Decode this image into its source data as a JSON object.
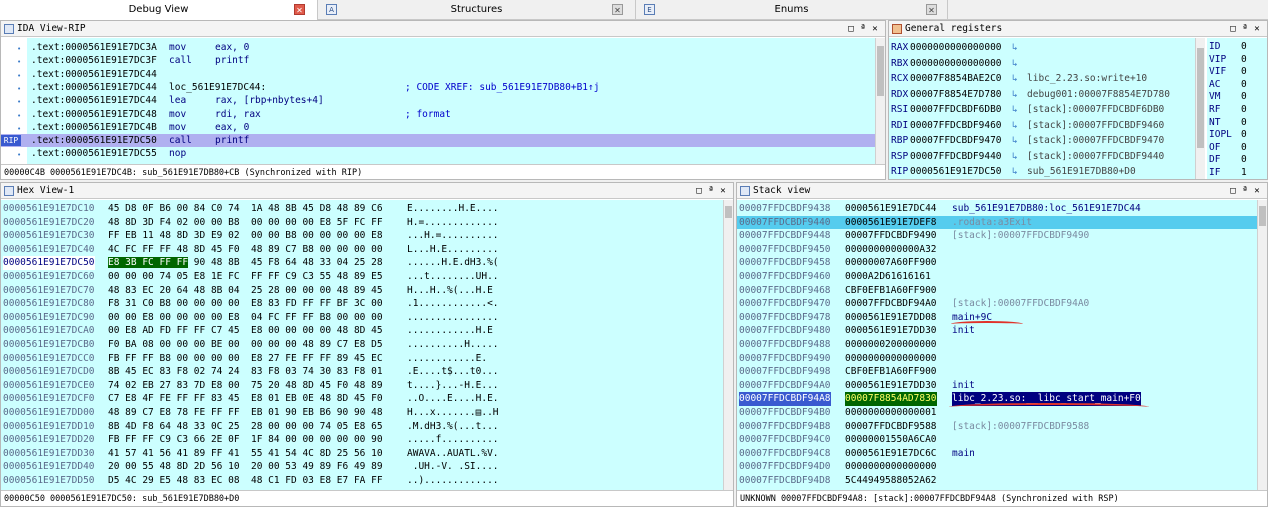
{
  "tabs": [
    {
      "label": "Debug View",
      "active": true
    },
    {
      "label": "Structures",
      "active": false
    },
    {
      "label": "Enums",
      "active": false
    }
  ],
  "ida_view": {
    "title": "IDA View-RIP",
    "rip_label": "RIP",
    "lines": [
      {
        "addr": ".text:0000561E91E7DC3A",
        "label": "",
        "mnem": "mov",
        "ops": "eax, 0",
        "hl": "eax",
        "comment": ""
      },
      {
        "addr": ".text:0000561E91E7DC3F",
        "label": "",
        "mnem": "call",
        "ops": "printf",
        "hl": "",
        "comment": ""
      },
      {
        "addr": ".text:0000561E91E7DC44",
        "label": "",
        "mnem": "",
        "ops": "",
        "hl": "",
        "comment": ""
      },
      {
        "addr": ".text:0000561E91E7DC44",
        "label": "loc_561E91E7DC44:",
        "mnem": "",
        "ops": "",
        "hl": "",
        "comment": "; CODE XREF: sub_561E91E7DB80+B1↑j"
      },
      {
        "addr": ".text:0000561E91E7DC44",
        "label": "",
        "mnem": "lea",
        "ops": "rax, [rbp+nbytes+4]",
        "hl": "rax",
        "comment": ""
      },
      {
        "addr": ".text:0000561E91E7DC48",
        "label": "",
        "mnem": "mov",
        "ops": "rdi, rax",
        "hl": "rax",
        "comment": "; format"
      },
      {
        "addr": ".text:0000561E91E7DC4B",
        "label": "",
        "mnem": "mov",
        "ops": "eax, 0",
        "hl": "eax",
        "comment": ""
      },
      {
        "addr": ".text:0000561E91E7DC50",
        "label": "",
        "mnem": "call",
        "ops": "printf",
        "hl": "",
        "comment": "",
        "current": true
      },
      {
        "addr": ".text:0000561E91E7DC55",
        "label": "",
        "mnem": "nop",
        "ops": "",
        "hl": "",
        "comment": ""
      }
    ],
    "status": "00000C4B 0000561E91E7DC4B: sub_561E91E7DB80+CB (Synchronized with RIP)"
  },
  "registers": {
    "title": "General registers",
    "rows": [
      {
        "name": "RAX",
        "value": "0000000000000000",
        "info": ""
      },
      {
        "name": "RBX",
        "value": "0000000000000000",
        "info": ""
      },
      {
        "name": "RCX",
        "value": "00007F8854BAE2C0",
        "info": "libc_2.23.so:write+10"
      },
      {
        "name": "RDX",
        "value": "00007F8854E7D780",
        "info": "debug001:00007F8854E7D780"
      },
      {
        "name": "RSI",
        "value": "00007FFDCBDF6DB0",
        "info": "[stack]:00007FFDCBDF6DB0"
      },
      {
        "name": "RDI",
        "value": "00007FFDCBDF9460",
        "info": "[stack]:00007FFDCBDF9460"
      },
      {
        "name": "RBP",
        "value": "00007FFDCBDF9470",
        "info": "[stack]:00007FFDCBDF9470"
      },
      {
        "name": "RSP",
        "value": "00007FFDCBDF9440",
        "info": "[stack]:00007FFDCBDF9440"
      },
      {
        "name": "RIP",
        "value": "0000561E91E7DC50",
        "info": "sub_561E91E7DB80+D0"
      }
    ],
    "flags": [
      {
        "name": "ID",
        "value": "0"
      },
      {
        "name": "VIP",
        "value": "0"
      },
      {
        "name": "VIF",
        "value": "0"
      },
      {
        "name": "AC",
        "value": "0"
      },
      {
        "name": "VM",
        "value": "0"
      },
      {
        "name": "RF",
        "value": "0"
      },
      {
        "name": "NT",
        "value": "0"
      },
      {
        "name": "IOPL",
        "value": "0"
      },
      {
        "name": "OF",
        "value": "0"
      },
      {
        "name": "DF",
        "value": "0"
      },
      {
        "name": "IF",
        "value": "1"
      }
    ]
  },
  "hex_view": {
    "title": "Hex View-1",
    "rows": [
      {
        "addr": "0000561E91E7DC10",
        "bytes": "45 D8 0F B6 00 84 C0 74  1A 48 8B 45 D8 48 89 C6",
        "ascii": "E........H.E...."
      },
      {
        "addr": "0000561E91E7DC20",
        "bytes": "48 8D 3D F4 02 00 00 B8  00 00 00 00 E8 5F FC FF",
        "ascii": "H.=............."
      },
      {
        "addr": "0000561E91E7DC30",
        "bytes": "FF EB 11 48 8D 3D E9 02  00 00 B8 00 00 00 00 E8",
        "ascii": "...H.=.........."
      },
      {
        "addr": "0000561E91E7DC40",
        "bytes": "4C FC FF FF 48 8D 45 F0  48 89 C7 B8 00 00 00 00",
        "ascii": "L...H.E........."
      },
      {
        "addr": "0000561E91E7DC50",
        "bytes": "E8 3B FC FF FF 90 48 8B  45 F8 64 48 33 04 25 28",
        "ascii": "......H.E.dH3.%(",
        "current": true,
        "hl_bytes": "E8 3B FC FF FF",
        "rest_bytes": " 90 48 8B  45 F8 64 48 33 04 25 28"
      },
      {
        "addr": "0000561E91E7DC60",
        "bytes": "00 00 00 74 05 E8 1E FC  FF FF C9 C3 55 48 89 E5",
        "ascii": "...t........UH.."
      },
      {
        "addr": "0000561E91E7DC70",
        "bytes": "48 83 EC 20 64 48 8B 04  25 28 00 00 00 48 89 45",
        "ascii": "H...H..%(...H.E"
      },
      {
        "addr": "0000561E91E7DC80",
        "bytes": "F8 31 C0 B8 00 00 00 00  E8 83 FD FF FF BF 3C 00",
        "ascii": ".1............<."
      },
      {
        "addr": "0000561E91E7DC90",
        "bytes": "00 00 E8 00 00 00 00 E8  04 FC FF FF B8 00 00 00",
        "ascii": "................"
      },
      {
        "addr": "0000561E91E7DCA0",
        "bytes": "00 E8 AD FD FF FF C7 45  E8 00 00 00 00 48 8D 45",
        "ascii": "............H.E"
      },
      {
        "addr": "0000561E91E7DCB0",
        "bytes": "F0 BA 08 00 00 00 BE 00  00 00 00 48 89 C7 E8 D5",
        "ascii": "..........H....."
      },
      {
        "addr": "0000561E91E7DCC0",
        "bytes": "FB FF FF B8 00 00 00 00  E8 27 FE FF FF 89 45 EC",
        "ascii": "............E."
      },
      {
        "addr": "0000561E91E7DCD0",
        "bytes": "8B 45 EC 83 F8 02 74 24  83 F8 03 74 30 83 F8 01",
        "ascii": ".E....t$...t0..."
      },
      {
        "addr": "0000561E91E7DCE0",
        "bytes": "74 02 EB 27 83 7D E8 00  75 20 48 8D 45 F0 48 89",
        "ascii": "t....}...-H.E..."
      },
      {
        "addr": "0000561E91E7DCF0",
        "bytes": "C7 E8 4F FE FF FF 83 45  E8 01 EB 0E 48 8D 45 F0",
        "ascii": "..O....E....H.E."
      },
      {
        "addr": "0000561E91E7DD00",
        "bytes": "48 89 C7 E8 78 FE FF FF  EB 01 90 EB B6 90 90 48",
        "ascii": "H...x.......▤..H"
      },
      {
        "addr": "0000561E91E7DD10",
        "bytes": "8B 4D F8 64 48 33 0C 25  28 00 00 00 74 05 E8 65",
        "ascii": ".M.dH3.%(...t..."
      },
      {
        "addr": "0000561E91E7DD20",
        "bytes": "FB FF FF C9 C3 66 2E 0F  1F 84 00 00 00 00 00 90",
        "ascii": ".....f.........."
      },
      {
        "addr": "0000561E91E7DD30",
        "bytes": "41 57 41 56 41 89 FF 41  55 41 54 4C 8D 25 56 10",
        "ascii": "AWAVA..AUATL.%V."
      },
      {
        "addr": "0000561E91E7DD40",
        "bytes": "20 00 55 48 8D 2D 56 10  20 00 53 49 89 F6 49 89",
        "ascii": " .UH.-V. .SI...."
      },
      {
        "addr": "0000561E91E7DD50",
        "bytes": "D5 4C 29 E5 48 83 EC 08  48 C1 FD 03 E8 E7 FA FF",
        "ascii": "..)............."
      }
    ],
    "status": "00000C50 0000561E91E7DC50: sub_561E91E7DB80+D0"
  },
  "stack_view": {
    "title": "Stack view",
    "rows": [
      {
        "addr": "00007FFDCBDF9438",
        "value": "0000561E91E7DC44",
        "info": "sub_561E91E7DB80:loc_561E91E7DC44",
        "kind": "lbl"
      },
      {
        "addr": "00007FFDCBDF9440",
        "value": "0000561E91E7DEF8",
        "info": ".rodata:a3Exit",
        "kind": "cmt",
        "current": true
      },
      {
        "addr": "00007FFDCBDF9448",
        "value": "00007FFDCBDF9490",
        "info": "[stack]:00007FFDCBDF9490",
        "kind": "cmt"
      },
      {
        "addr": "00007FFDCBDF9450",
        "value": "0000000000000A32",
        "info": "",
        "kind": ""
      },
      {
        "addr": "00007FFDCBDF9458",
        "value": "00000007A60FF900",
        "info": "",
        "kind": ""
      },
      {
        "addr": "00007FFDCBDF9460",
        "value": "0000A2D61616161",
        "info": "",
        "kind": ""
      },
      {
        "addr": "00007FFDCBDF9468",
        "value": "CBF0EFB1A60FF900",
        "info": "",
        "kind": ""
      },
      {
        "addr": "00007FFDCBDF9470",
        "value": "00007FFDCBDF94A0",
        "info": "[stack]:00007FFDCBDF94A0",
        "kind": "cmt"
      },
      {
        "addr": "00007FFDCBDF9478",
        "value": "0000561E91E7DD08",
        "info": "main+9C",
        "kind": "lbl"
      },
      {
        "addr": "00007FFDCBDF9480",
        "value": "0000561E91E7DD30",
        "info": "init",
        "kind": "lbl"
      },
      {
        "addr": "00007FFDCBDF9488",
        "value": "0000000200000000",
        "info": "",
        "kind": ""
      },
      {
        "addr": "00007FFDCBDF9490",
        "value": "0000000000000000",
        "info": "",
        "kind": ""
      },
      {
        "addr": "00007FFDCBDF9498",
        "value": "CBF0EFB1A60FF900",
        "info": "",
        "kind": ""
      },
      {
        "addr": "00007FFDCBDF94A0",
        "value": "0000561E91E7DD30",
        "info": "init",
        "kind": "lbl"
      },
      {
        "addr": "00007FFDCBDF94A8",
        "value": "00007F8854AD7830",
        "info": "libc_2.23.so:__libc_start_main+F0",
        "kind": "sel"
      },
      {
        "addr": "00007FFDCBDF94B0",
        "value": "0000000000000001",
        "info": "",
        "kind": ""
      },
      {
        "addr": "00007FFDCBDF94B8",
        "value": "00007FFDCBDF9588",
        "info": "[stack]:00007FFDCBDF9588",
        "kind": "cmt"
      },
      {
        "addr": "00007FFDCBDF94C0",
        "value": "00000001550A6CA0",
        "info": "",
        "kind": ""
      },
      {
        "addr": "00007FFDCBDF94C8",
        "value": "0000561E91E7DC6C",
        "info": "main",
        "kind": "lbl"
      },
      {
        "addr": "00007FFDCBDF94D0",
        "value": "0000000000000000",
        "info": "",
        "kind": ""
      },
      {
        "addr": "00007FFDCBDF94D8",
        "value": "5C44949588052A62",
        "info": "",
        "kind": ""
      }
    ],
    "status": "UNKNOWN 00007FFDCBDF94A8: [stack]:00007FFDCBDF94A8 (Synchronized with RSP)"
  },
  "colors": {
    "code_bg": "#ccffff",
    "highlight_row": "#b0b0f0",
    "stack_selected_row": "#55ccee",
    "hex_current_bytes": "#006600",
    "annotation": "#e0322a"
  }
}
